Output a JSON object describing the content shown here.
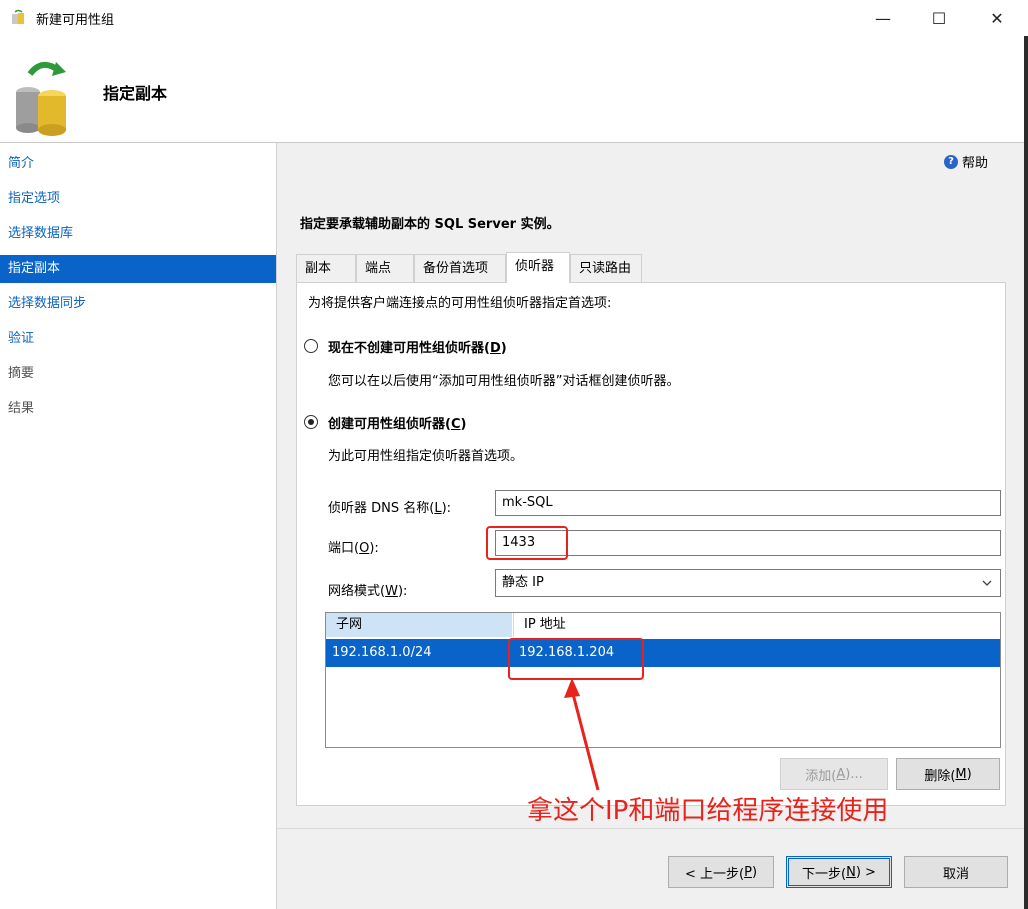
{
  "window": {
    "title": "新建可用性组",
    "minimize": "—",
    "maximize": "☐",
    "close": "✕"
  },
  "header": {
    "title": "指定副本"
  },
  "sidebar": {
    "items": [
      {
        "label": "简介",
        "state": "link"
      },
      {
        "label": "指定选项",
        "state": "link"
      },
      {
        "label": "选择数据库",
        "state": "link"
      },
      {
        "label": "指定副本",
        "state": "active"
      },
      {
        "label": "选择数据同步",
        "state": "link"
      },
      {
        "label": "验证",
        "state": "link"
      },
      {
        "label": "摘要",
        "state": "disabled"
      },
      {
        "label": "结果",
        "state": "disabled"
      }
    ]
  },
  "help": {
    "label": "帮助",
    "icon": "help-icon"
  },
  "instruction": "指定要承载辅助副本的 SQL Server 实例。",
  "tabs": [
    {
      "label": "副本"
    },
    {
      "label": "端点"
    },
    {
      "label": "备份首选项"
    },
    {
      "label": "侦听器"
    },
    {
      "label": "只读路由"
    }
  ],
  "panel": {
    "description": "为将提供客户端连接点的可用性组侦听器指定首选项:",
    "option_none": {
      "label_prefix": "现在不创建可用性组侦听器(",
      "mnemonic": "D",
      "label_suffix": ")",
      "note": "您可以在以后使用“添加可用性组侦听器”对话框创建侦听器。",
      "checked": false
    },
    "option_create": {
      "label_prefix": "创建可用性组侦听器(",
      "mnemonic": "C",
      "label_suffix": ")",
      "note": "为此可用性组指定侦听器首选项。",
      "checked": true
    },
    "dns": {
      "label_prefix": "侦听器 DNS 名称(",
      "mnemonic": "L",
      "label_suffix": "):",
      "value": "mk-SQL"
    },
    "port": {
      "label_prefix": "端口(",
      "mnemonic": "O",
      "label_suffix": "):",
      "value": "1433"
    },
    "network": {
      "label_prefix": "网络模式(",
      "mnemonic": "W",
      "label_suffix": "):",
      "value": "静态 IP"
    },
    "grid": {
      "columns": [
        "子网",
        "IP 地址"
      ],
      "rows": [
        {
          "subnet": "192.168.1.0/24",
          "ip": "192.168.1.204"
        }
      ]
    },
    "add_button": {
      "label_prefix": "添加(",
      "mnemonic": "A",
      "label_suffix": ")..."
    },
    "remove_button": {
      "label_prefix": "删除(",
      "mnemonic": "M",
      "label_suffix": ")"
    }
  },
  "footer": {
    "prev": {
      "label_prefix": "< 上一步(",
      "mnemonic": "P",
      "label_suffix": ")"
    },
    "next": {
      "label_prefix": "下一步(",
      "mnemonic": "N",
      "label_suffix": ") >"
    },
    "cancel": "取消"
  },
  "annotation": {
    "text": "拿这个IP和端口给程序连接使用",
    "color": "#e8231c"
  },
  "colors": {
    "accent": "#0a63c8",
    "link": "#0b63c1",
    "annotation": "#e8231c"
  }
}
